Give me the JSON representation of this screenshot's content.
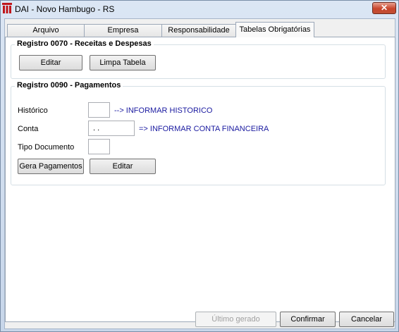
{
  "window": {
    "title": "DAI - Novo Hambugo - RS",
    "close_glyph": "✕"
  },
  "tabs": [
    {
      "label": "Arquivo"
    },
    {
      "label": "Empresa"
    },
    {
      "label": "Responsabilidade"
    },
    {
      "label": "Tabelas Obrigatórias"
    }
  ],
  "group_0070": {
    "legend": "Registro 0070 - Receitas e Despesas",
    "edit_button": "Editar",
    "clear_button": "Limpa Tabela"
  },
  "group_0090": {
    "legend": "Registro 0090 - Pagamentos",
    "historico_label": "Histórico",
    "historico_value": "",
    "historico_hint": "--> INFORMAR HISTORICO",
    "conta_label": "Conta",
    "conta_value": ". .",
    "conta_hint": "=> INFORMAR CONTA FINANCEIRA",
    "tipo_label": "Tipo Documento",
    "tipo_value": "",
    "gera_button": "Gera Pagamentos",
    "edit_button": "Editar"
  },
  "footer": {
    "ultimo_button": "Último gerado",
    "confirm_button": "Confirmar",
    "cancel_button": "Cancelar"
  }
}
